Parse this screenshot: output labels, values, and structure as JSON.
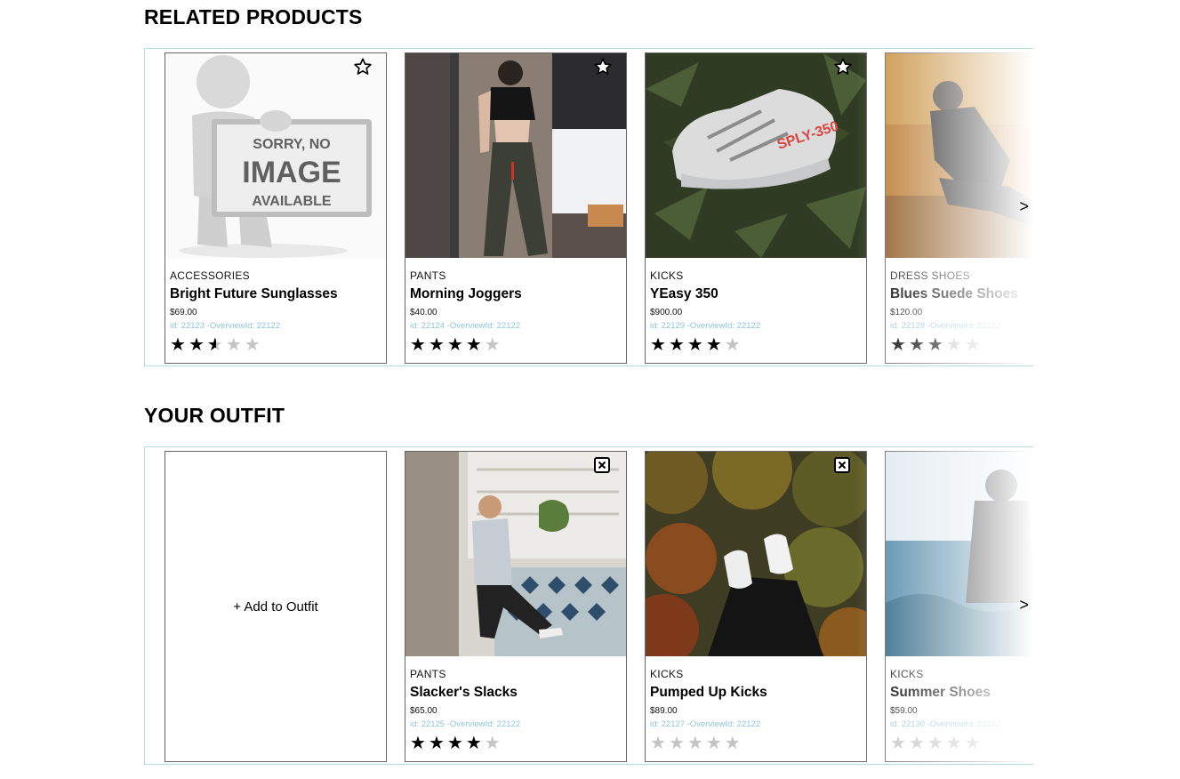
{
  "related": {
    "title": "RELATED PRODUCTS",
    "next_arrow": ">",
    "cards": [
      {
        "category": "ACCESSORIES",
        "name": "Bright Future Sunglasses",
        "price": "$69.00",
        "ids": "id: 22123 -OverviewId: 22122",
        "rating": 2.5,
        "image": "no-image-placeholder",
        "action_icon": "star-outline-icon"
      },
      {
        "category": "PANTS",
        "name": "Morning Joggers",
        "price": "$40.00",
        "ids": "id: 22124 -OverviewId: 22122",
        "rating": 4,
        "image": "woman-in-joggers-photo",
        "action_icon": "star-outline-icon"
      },
      {
        "category": "KICKS",
        "name": "YEasy 350",
        "price": "$900.00",
        "ids": "id: 22129 -OverviewId: 22122",
        "rating": 4,
        "image": "sneaker-on-leaves-photo",
        "action_icon": "star-outline-icon"
      },
      {
        "category": "DRESS SHOES",
        "name": "Blues Suede Shoes",
        "price": "$120.00",
        "ids": "id: 22128 -OverviewId: 22122",
        "rating": 3,
        "image": "man-on-fur-photo",
        "action_icon": "star-outline-icon"
      }
    ]
  },
  "outfit": {
    "title": "YOUR OUTFIT",
    "next_arrow": ">",
    "add_label": "+ Add to Outfit",
    "cards": [
      {
        "category": "PANTS",
        "name": "Slacker's Slacks",
        "price": "$65.00",
        "ids": "id: 22125 -OverviewId: 22122",
        "rating": 4,
        "image": "man-in-cafe-photo",
        "action_icon": "close-box-icon"
      },
      {
        "category": "KICKS",
        "name": "Pumped Up Kicks",
        "price": "$89.00",
        "ids": "id: 22127 -OverviewId: 22122",
        "rating": 0,
        "image": "sneakers-over-forest-photo",
        "action_icon": "close-box-icon"
      },
      {
        "category": "KICKS",
        "name": "Summer Shoes",
        "price": "$59.00",
        "ids": "id: 22130 -OverviewId: 22122",
        "rating": 0,
        "image": "person-at-sea-photo",
        "action_icon": "close-box-icon"
      }
    ]
  },
  "colors": {
    "id_text": "#8fc4d8",
    "carousel_border": "#b9dbe6",
    "star_filled": "#000000",
    "star_empty": "#c4c4c4"
  }
}
